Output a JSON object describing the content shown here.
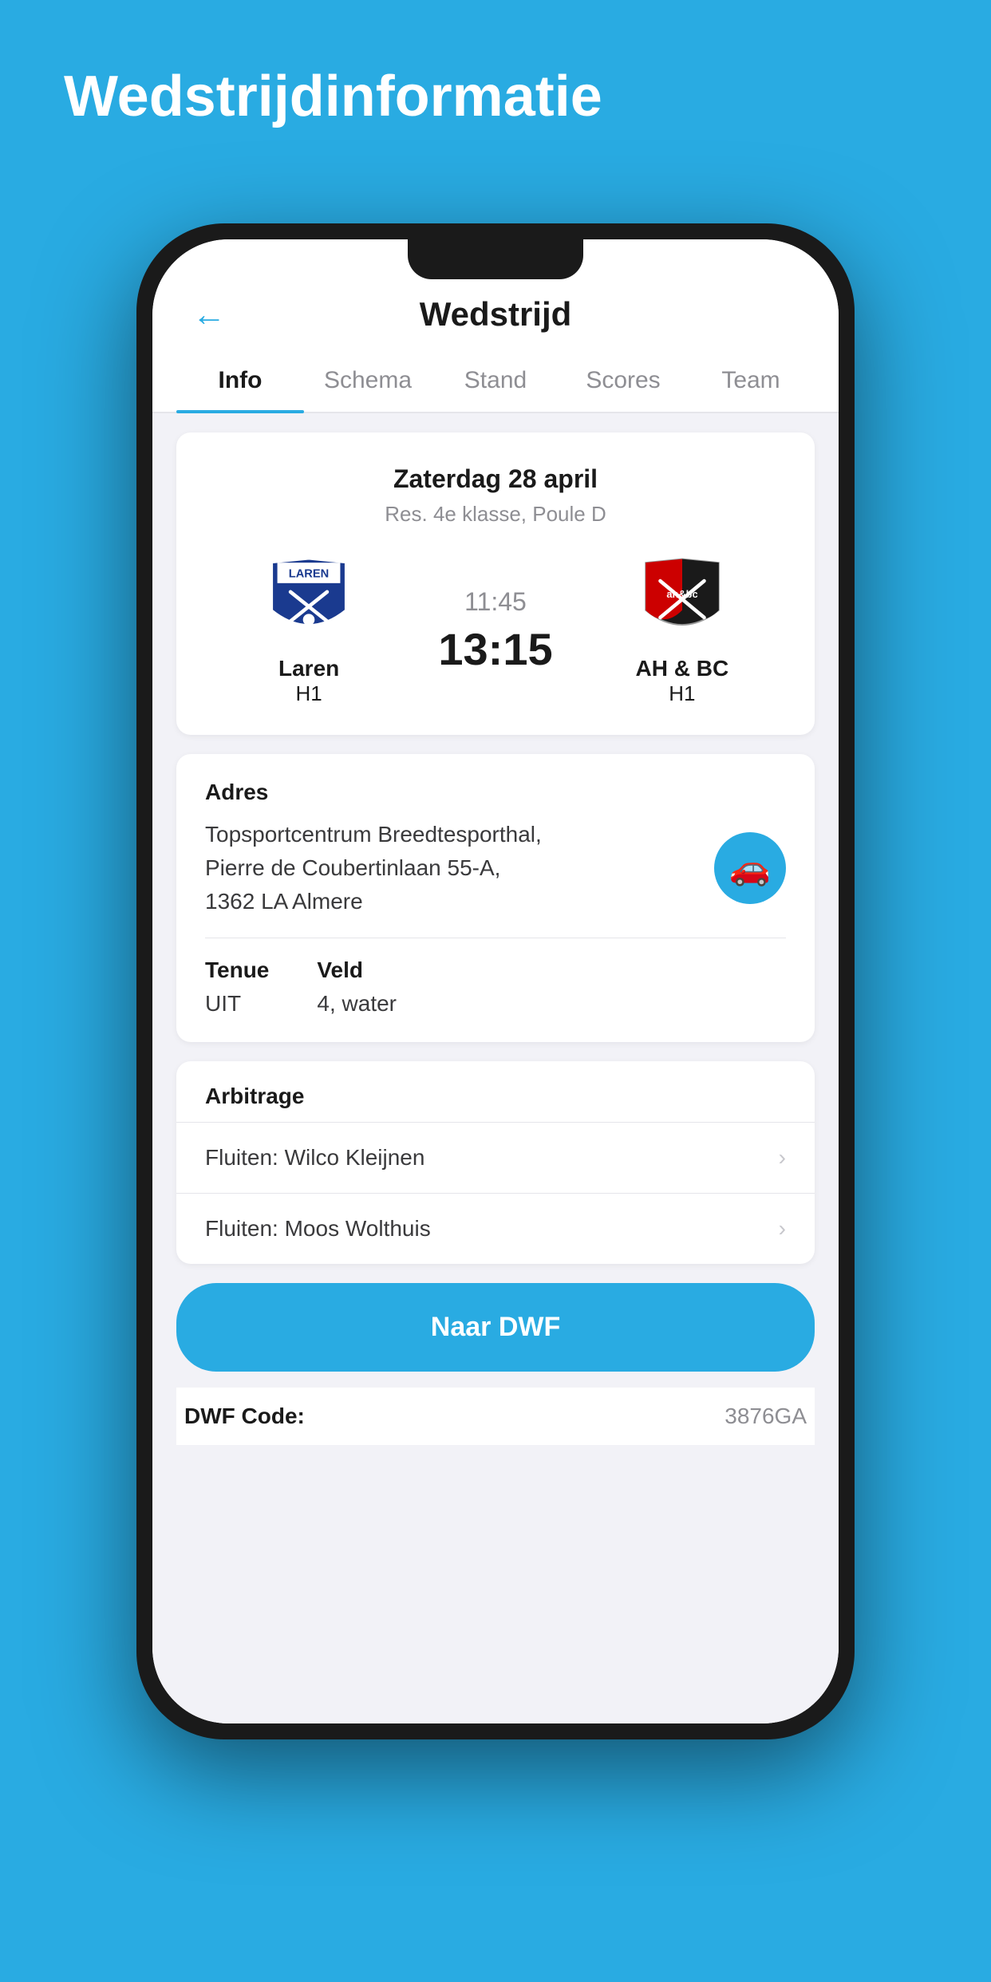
{
  "page": {
    "background_title": "Wedstrijdinformatie",
    "header": {
      "back_label": "←",
      "title": "Wedstrijd"
    },
    "tabs": [
      {
        "label": "Info",
        "active": true
      },
      {
        "label": "Schema",
        "active": false
      },
      {
        "label": "Stand",
        "active": false
      },
      {
        "label": "Scores",
        "active": false
      },
      {
        "label": "Team",
        "active": false
      }
    ],
    "match": {
      "date": "Zaterdag 28 april",
      "competition": "Res. 4e klasse, Poule D",
      "home_team": {
        "name": "Laren",
        "class": "H1"
      },
      "away_team": {
        "name": "AH & BC",
        "class": "H1"
      },
      "time": "11:45",
      "score": "13:15"
    },
    "address": {
      "label": "Adres",
      "text_line1": "Topsportcentrum Breedtesporthal,",
      "text_line2": "Pierre de Coubertinlaan 55-A,",
      "text_line3": "1362 LA Almere"
    },
    "tenue": {
      "label": "Tenue",
      "value": "UIT"
    },
    "veld": {
      "label": "Veld",
      "value": "4, water"
    },
    "arbitrage": {
      "label": "Arbitrage",
      "referees": [
        {
          "text": "Fluiten: Wilco Kleijnen"
        },
        {
          "text": "Fluiten: Moos Wolthuis"
        }
      ]
    },
    "dwf_button": {
      "label": "Naar DWF"
    },
    "dwf_code": {
      "label": "DWF Code:",
      "value": "3876GA"
    }
  }
}
